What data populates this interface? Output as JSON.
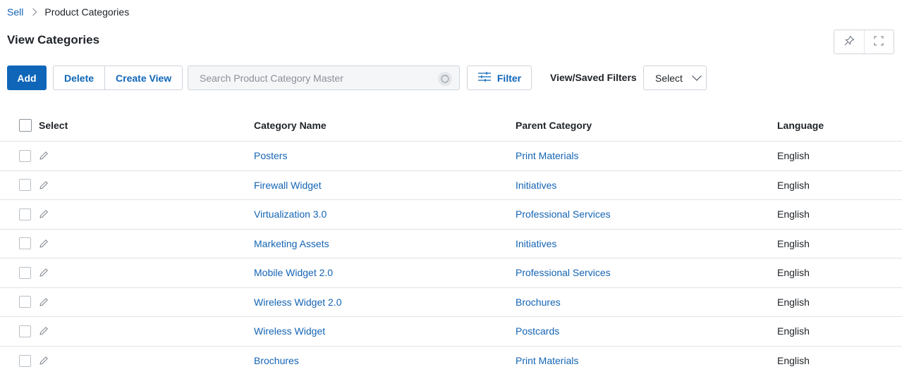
{
  "breadcrumb": {
    "root": "Sell",
    "current": "Product Categories"
  },
  "page_title": "View Categories",
  "toolbar": {
    "add_label": "Add",
    "delete_label": "Delete",
    "create_view_label": "Create View",
    "search_placeholder": "Search Product Category Master",
    "filter_label": "Filter",
    "saved_filters_label": "View/Saved Filters",
    "saved_filters_value": "Select"
  },
  "table": {
    "headers": {
      "select": "Select",
      "name": "Category Name",
      "parent": "Parent Category",
      "language": "Language"
    },
    "rows": [
      {
        "name": "Posters",
        "parent": "Print Materials",
        "language": "English"
      },
      {
        "name": "Firewall Widget",
        "parent": "Initiatives",
        "language": "English"
      },
      {
        "name": "Virtualization 3.0",
        "parent": "Professional Services",
        "language": "English"
      },
      {
        "name": "Marketing Assets",
        "parent": "Initiatives",
        "language": "English"
      },
      {
        "name": "Mobile Widget 2.0",
        "parent": "Professional Services",
        "language": "English"
      },
      {
        "name": "Wireless Widget 2.0",
        "parent": "Brochures",
        "language": "English"
      },
      {
        "name": "Wireless Widget",
        "parent": "Postcards",
        "language": "English"
      },
      {
        "name": "Brochures",
        "parent": "Print Materials",
        "language": "English"
      }
    ]
  },
  "colors": {
    "accent": "#0f66b8",
    "link": "#1464b4",
    "border": "#dfe2e6"
  }
}
